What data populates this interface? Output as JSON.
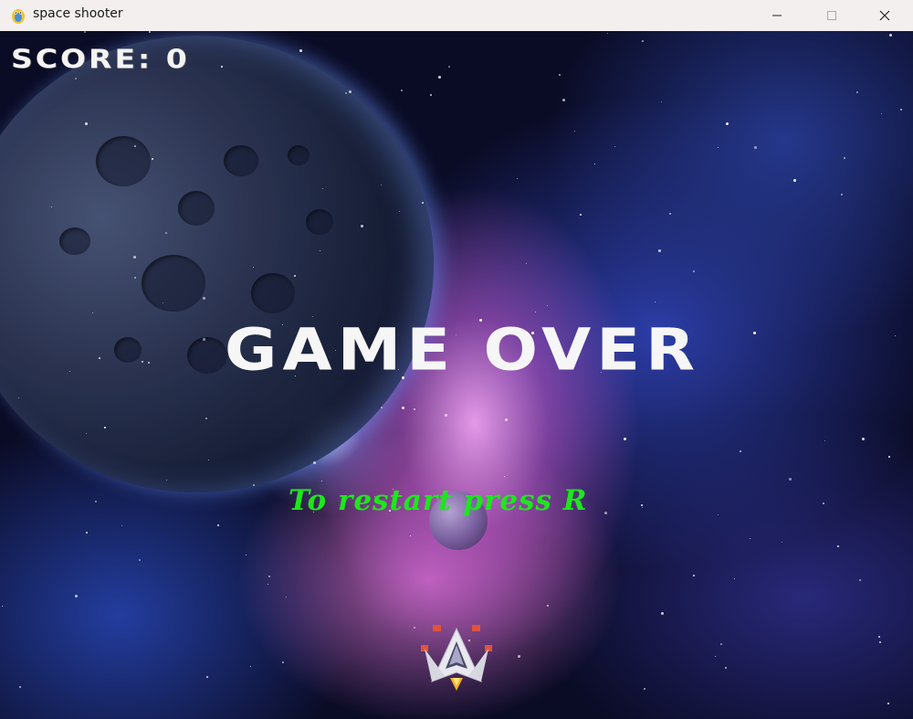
{
  "window": {
    "title": "space shooter"
  },
  "hud": {
    "score_label": "SCORE:",
    "score_value": "0"
  },
  "overlay": {
    "game_over": "GAME OVER",
    "restart_hint": "To restart press R"
  },
  "colors": {
    "score_text": "#f4f4f4",
    "game_over_text": "#f6f6f6",
    "restart_text": "#1ee61e"
  },
  "icons": {
    "app": "pygame-snake-icon",
    "minimize": "minimize-icon",
    "maximize": "maximize-icon",
    "close": "close-icon",
    "player": "spaceship-icon"
  }
}
